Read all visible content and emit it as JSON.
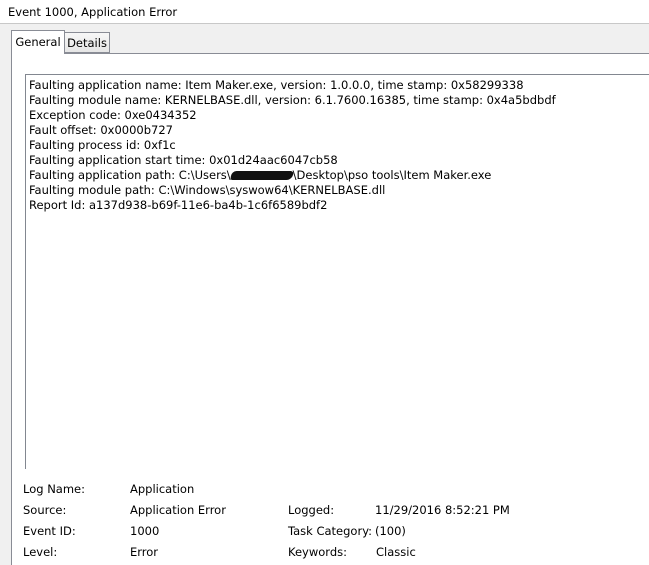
{
  "window": {
    "title": "Event 1000, Application Error"
  },
  "tabs": [
    {
      "label": "General",
      "selected": true
    },
    {
      "label": "Details",
      "selected": false
    }
  ],
  "description": {
    "lines": [
      "Faulting application name: Item Maker.exe, version: 1.0.0.0, time stamp: 0x58299338",
      "Faulting module name: KERNELBASE.dll, version: 6.1.7600.16385, time stamp: 0x4a5bdbdf",
      "Exception code: 0xe0434352",
      "Fault offset: 0x0000b727",
      "Faulting process id: 0xf1c",
      "Faulting application start time: 0x01d24aac6047cb58",
      "Faulting application path: C:\\Users\\",
      "Faulting module path: C:\\Windows\\syswow64\\KERNELBASE.dll",
      "Report Id: a137d938-b69f-11e6-ba4b-1c6f6589bdf2"
    ],
    "path_suffix": "\\Desktop\\pso tools\\Item Maker.exe"
  },
  "properties": {
    "log_name": {
      "label": "Log Name:",
      "value": "Application"
    },
    "source": {
      "label": "Source:",
      "value": "Application Error"
    },
    "event_id": {
      "label": "Event ID:",
      "value": "1000"
    },
    "level": {
      "label": "Level:",
      "value": "Error"
    },
    "logged": {
      "label": "Logged:",
      "value": "11/29/2016 8:52:21 PM"
    },
    "task_category": {
      "label": "Task Category:",
      "value": "(100)"
    },
    "keywords": {
      "label": "Keywords:",
      "value": "Classic"
    }
  }
}
